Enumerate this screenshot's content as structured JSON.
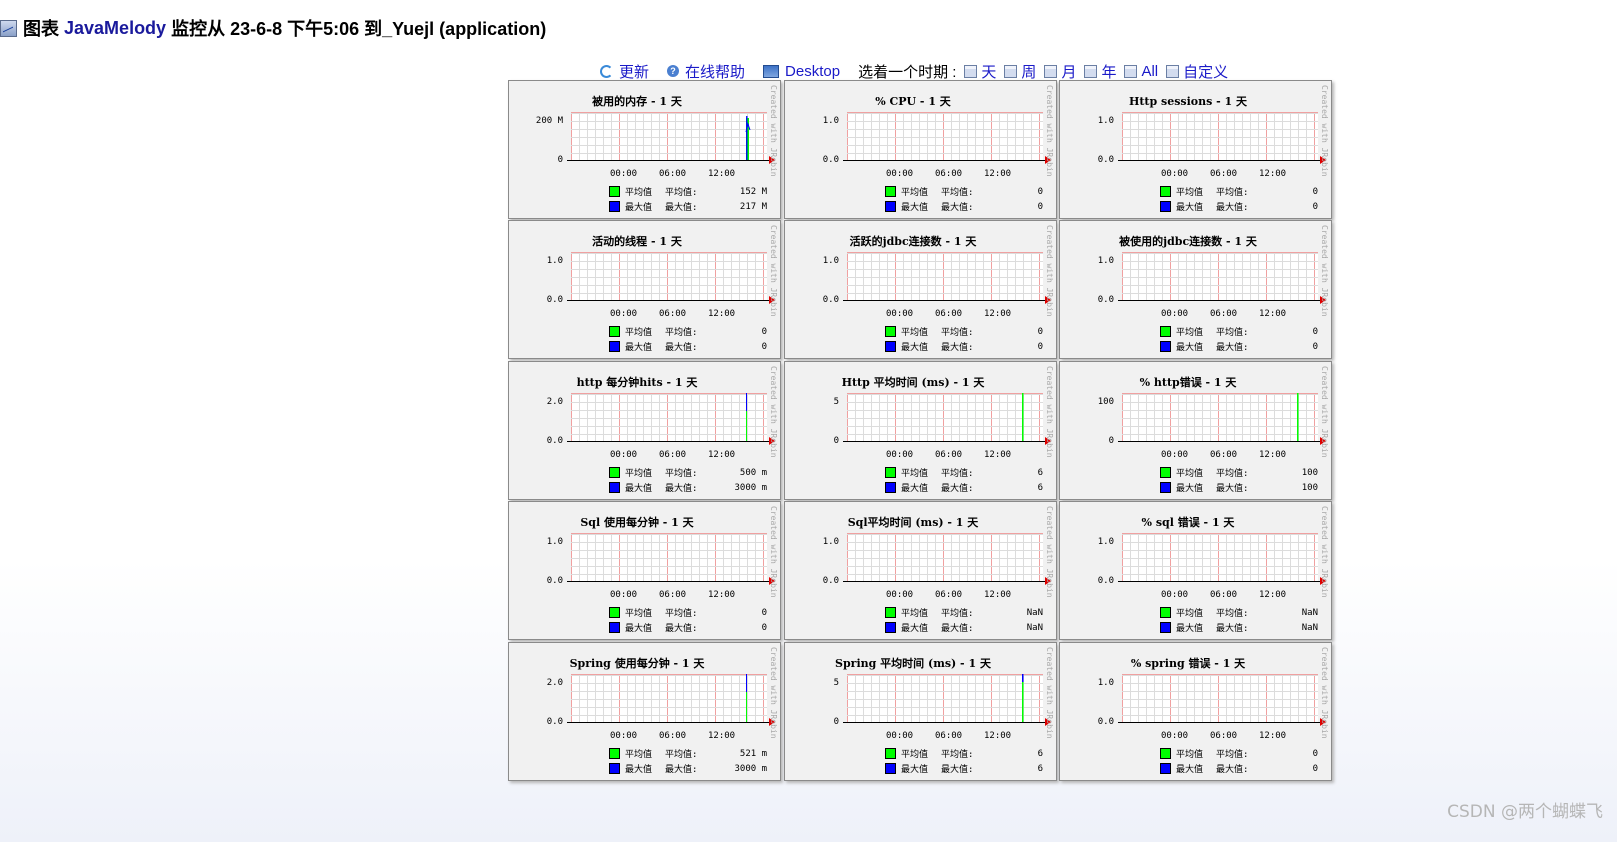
{
  "header": {
    "prefix": "图表",
    "brand": "JavaMelody",
    "text": "监控从 23-6-8 下午5:06 到_Yuejl (application)"
  },
  "toolbar": {
    "refresh": "更新",
    "help": "在线帮助",
    "desktop": "Desktop",
    "period_label": "选着一个时期 :",
    "periods": [
      "天",
      "周",
      "月",
      "年",
      "All",
      "自定义"
    ]
  },
  "legend": {
    "avg_label": "平均值",
    "max_label": "最大值",
    "avg_colon": "平均值:",
    "max_colon": "最大值:",
    "avg_color": "#00ff00",
    "max_color": "#0000ff"
  },
  "x_ticks": [
    "00:00",
    "06:00",
    "12:00"
  ],
  "watermark": "Created with JRobin",
  "charts": [
    {
      "title": "被用的内存 - 1 天",
      "y_ticks": [
        "200 M",
        "0"
      ],
      "avg": "152 M",
      "max": "217 M",
      "spike": "memory"
    },
    {
      "title": "% CPU - 1 天",
      "y_ticks": [
        "1.0",
        "0.0"
      ],
      "avg": "0",
      "max": "0",
      "spike": "none"
    },
    {
      "title": "Http sessions - 1 天",
      "y_ticks": [
        "1.0",
        "0.0"
      ],
      "avg": "0",
      "max": "0",
      "spike": "none"
    },
    {
      "title": "活动的线程 - 1 天",
      "y_ticks": [
        "1.0",
        "0.0"
      ],
      "avg": "0",
      "max": "0",
      "spike": "none"
    },
    {
      "title": "活跃的jdbc连接数 - 1 天",
      "y_ticks": [
        "1.0",
        "0.0"
      ],
      "avg": "0",
      "max": "0",
      "spike": "none"
    },
    {
      "title": "被使用的jdbc连接数 - 1 天",
      "y_ticks": [
        "1.0",
        "0.0"
      ],
      "avg": "0",
      "max": "0",
      "spike": "none"
    },
    {
      "title": "http 每分钟hits - 1 天",
      "y_ticks": [
        "2.0",
        "0.0"
      ],
      "avg": "500 m",
      "max": "3000 m",
      "spike": "blue-green"
    },
    {
      "title": "Http 平均时间 (ms) - 1 天",
      "y_ticks": [
        "5",
        "0"
      ],
      "avg": "6",
      "max": "6",
      "spike": "green-tall"
    },
    {
      "title": "% http错误 - 1 天",
      "y_ticks": [
        "100",
        "0"
      ],
      "avg": "100",
      "max": "100",
      "spike": "green-tall"
    },
    {
      "title": "Sql 使用每分钟 - 1 天",
      "y_ticks": [
        "1.0",
        "0.0"
      ],
      "avg": "0",
      "max": "0",
      "spike": "none"
    },
    {
      "title": "Sql平均时间 (ms) - 1 天",
      "y_ticks": [
        "1.0",
        "0.0"
      ],
      "avg": "NaN",
      "max": "NaN",
      "spike": "none"
    },
    {
      "title": "% sql 错误 - 1 天",
      "y_ticks": [
        "1.0",
        "0.0"
      ],
      "avg": "NaN",
      "max": "NaN",
      "spike": "none"
    },
    {
      "title": "Spring 使用每分钟 - 1 天",
      "y_ticks": [
        "2.0",
        "0.0"
      ],
      "avg": "521 m",
      "max": "3000 m",
      "spike": "blue-green"
    },
    {
      "title": "Spring 平均时间 (ms) - 1 天",
      "y_ticks": [
        "5",
        "0"
      ],
      "avg": "6",
      "max": "6",
      "spike": "green-blue-top"
    },
    {
      "title": "% spring 错误 - 1 天",
      "y_ticks": [
        "1.0",
        "0.0"
      ],
      "avg": "0",
      "max": "0",
      "spike": "none"
    }
  ],
  "footer": {
    "credit": "CSDN @两个蝴蝶飞"
  }
}
